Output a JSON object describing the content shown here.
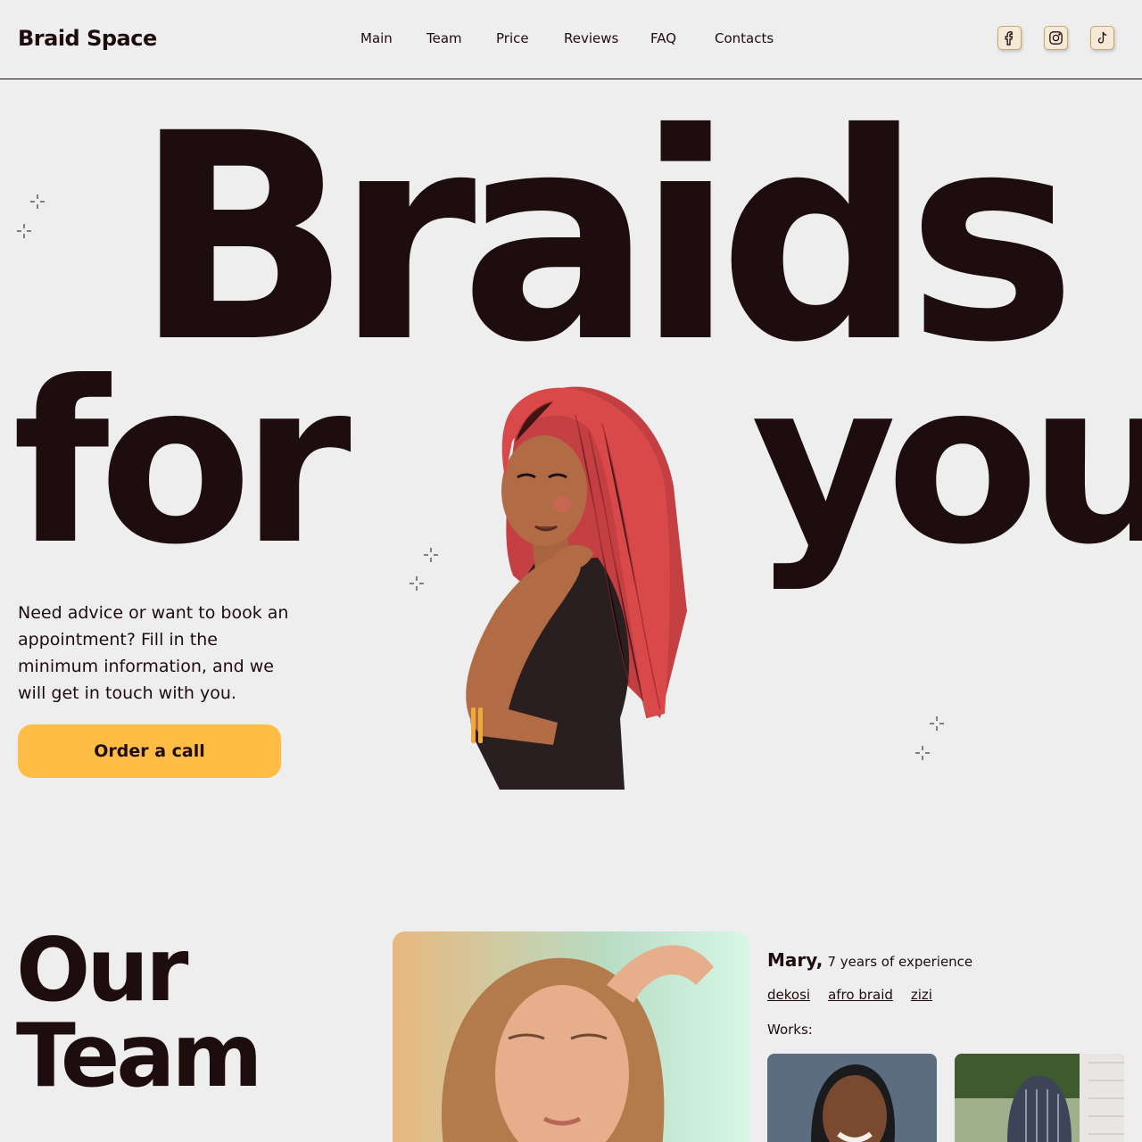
{
  "header": {
    "logo": "Braid Space",
    "nav": [
      "Main",
      "Team",
      "Price",
      "Reviews",
      "FAQ",
      "Contacts"
    ],
    "social": [
      "facebook-icon",
      "instagram-icon",
      "tiktok-icon"
    ]
  },
  "hero": {
    "title_line1": "Braids",
    "title_word_for": "for",
    "title_word_you": "you",
    "description": "Need advice or want to book an appointment? Fill in the minimum information, and we will get in touch with you.",
    "cta_label": "Order a call"
  },
  "team": {
    "title_line1": "Our",
    "title_line2": "Team",
    "member": {
      "name": "Mary,",
      "experience": "7 years of experience",
      "tags": [
        "dekosi",
        "afro braid",
        "zizi"
      ],
      "works_label": "Works:"
    }
  },
  "colors": {
    "background": "#eeeeee",
    "text": "#1e0d0f",
    "accent": "#ffbd45",
    "hair": "#d9494a"
  }
}
